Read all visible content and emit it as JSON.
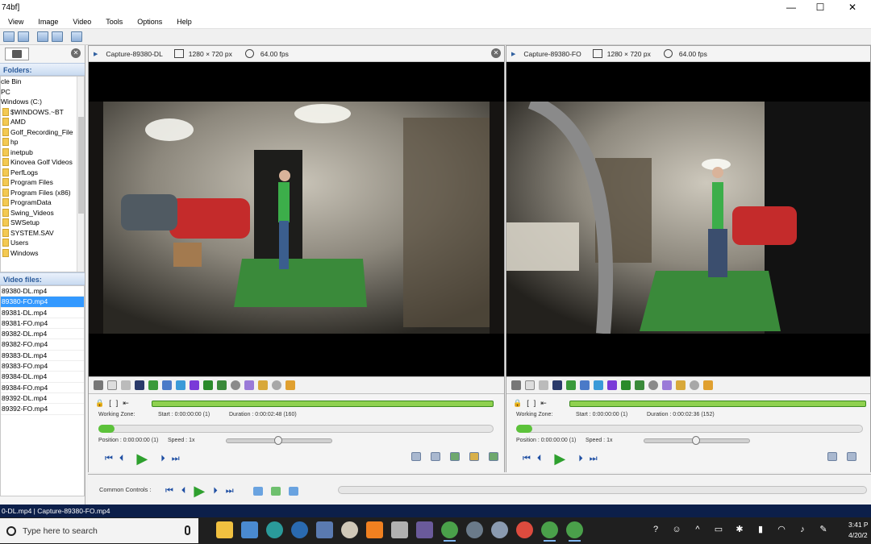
{
  "window": {
    "title": "74bf]",
    "controls": {
      "minimize": "—",
      "maximize": "☐",
      "close": "✕"
    }
  },
  "menu": [
    "View",
    "Image",
    "Video",
    "Tools",
    "Options",
    "Help"
  ],
  "explorer": {
    "folders_label": "Folders:",
    "tree": [
      {
        "label": "cle Bin",
        "folder": false
      },
      {
        "label": "PC",
        "folder": false
      },
      {
        "label": "Windows (C:)",
        "folder": false
      },
      {
        "label": "$WINDOWS.~BT",
        "folder": true
      },
      {
        "label": "AMD",
        "folder": true
      },
      {
        "label": "Golf_Recording_File",
        "folder": true
      },
      {
        "label": "hp",
        "folder": true
      },
      {
        "label": "inetpub",
        "folder": true
      },
      {
        "label": "Kinovea Golf Videos",
        "folder": true
      },
      {
        "label": "PerfLogs",
        "folder": true
      },
      {
        "label": "Program Files",
        "folder": true
      },
      {
        "label": "Program Files (x86)",
        "folder": true
      },
      {
        "label": "ProgramData",
        "folder": true
      },
      {
        "label": "Swing_Videos",
        "folder": true
      },
      {
        "label": "SWSetup",
        "folder": true
      },
      {
        "label": "SYSTEM.SAV",
        "folder": true
      },
      {
        "label": "Users",
        "folder": true
      },
      {
        "label": "Windows",
        "folder": true
      }
    ],
    "files_label": "Video files:",
    "files": [
      "89380-DL.mp4",
      "89380-FO.mp4",
      "89381-DL.mp4",
      "89381-FO.mp4",
      "89382-DL.mp4",
      "89382-FO.mp4",
      "89383-DL.mp4",
      "89383-FO.mp4",
      "89384-DL.mp4",
      "89384-FO.mp4",
      "89392-DL.mp4",
      "89392-FO.mp4"
    ],
    "selected_index": 1
  },
  "players": [
    {
      "name": "Capture-89380-DL",
      "resolution": "1280 × 720 px",
      "fps": "64.00 fps",
      "working_zone_label": "Working Zone:",
      "start": "Start : 0:00:00:00 (1)",
      "duration": "Duration : 0:00:02:48 (160)",
      "position": "Position : 0:00:00:00 (1)",
      "speed": "Speed : 1x"
    },
    {
      "name": "Capture-89380-FO",
      "resolution": "1280 × 720 px",
      "fps": "64.00 fps",
      "working_zone_label": "Working Zone:",
      "start": "Start : 0:00:00:00 (1)",
      "duration": "Duration : 0:00:02:36 (152)",
      "position": "Position : 0:00:00:00 (1)",
      "speed": "Speed : 1x"
    }
  ],
  "common_controls_label": "Common Controls :",
  "status_text": "0-DL.mp4 | Capture-89380-FO.mp4",
  "taskbar": {
    "search_placeholder": "Type here to search",
    "time": "3:41 P",
    "date": "4/20/2"
  },
  "colors": {
    "accent_blue": "#3399ff",
    "timeline_green": "#8fd14f",
    "play_green": "#2ea02e",
    "status_bar": "#0c1f4a"
  }
}
